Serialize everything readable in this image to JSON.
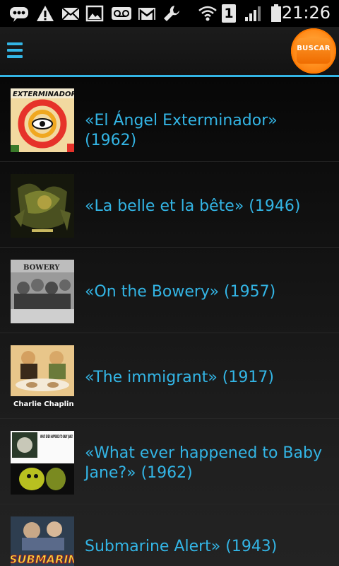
{
  "status": {
    "time": "21:26",
    "sim": "1",
    "icons": [
      "bbm-icon",
      "warning-icon",
      "mail-icon",
      "image-icon",
      "voicemail-icon",
      "gmail-icon",
      "wrench-icon",
      "wifi-icon",
      "sim-icon",
      "signal-icon",
      "battery-icon"
    ]
  },
  "header": {
    "search_label": "BUSCAR",
    "accent": "#33b5e5",
    "brand": "#ff8c1a"
  },
  "poster_texts": {
    "exterminador": "EXTERMINADOR",
    "bowery": "BOWERY",
    "chaplin": "Charlie Chaplin",
    "babyjane": "WHAT EVER HAPPENED TO BABY JANE?",
    "submarine": "SUBMARINE ALERT"
  },
  "movies": [
    {
      "title": "«El Ángel Exterminador» (1962)"
    },
    {
      "title": "«La belle et la bête» (1946)"
    },
    {
      "title": "«On the Bowery» (1957)"
    },
    {
      "title": "«The immigrant» (1917)"
    },
    {
      "title": "«What ever happened to Baby Jane?» (1962)"
    },
    {
      "title": "Submarine Alert» (1943)"
    }
  ]
}
